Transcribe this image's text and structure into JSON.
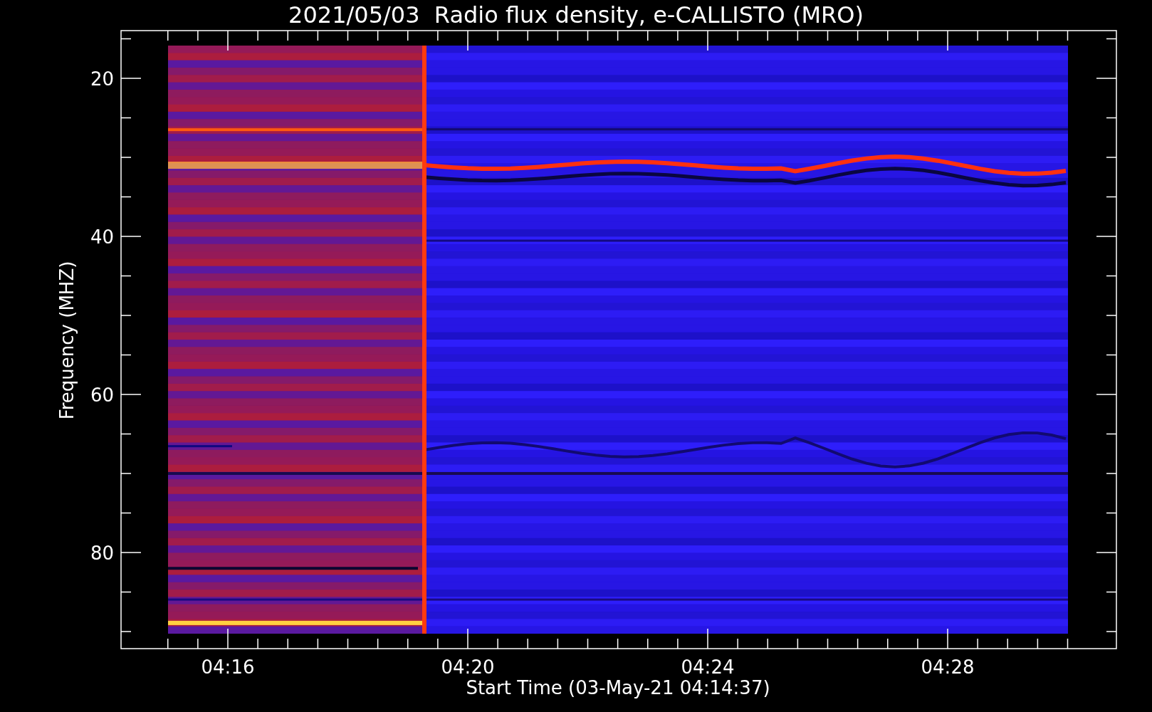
{
  "title": "2021/05/03  Radio flux density, e-CALLISTO (MRO)",
  "plot": {
    "ylabel": "Frequency (MHZ)",
    "xlabel": "Start Time (03-May-21 04:14:37)",
    "yticks": [
      "20",
      "40",
      "60",
      "80"
    ],
    "xticks": [
      "04:16",
      "04:20",
      "04:24",
      "04:28"
    ]
  }
}
